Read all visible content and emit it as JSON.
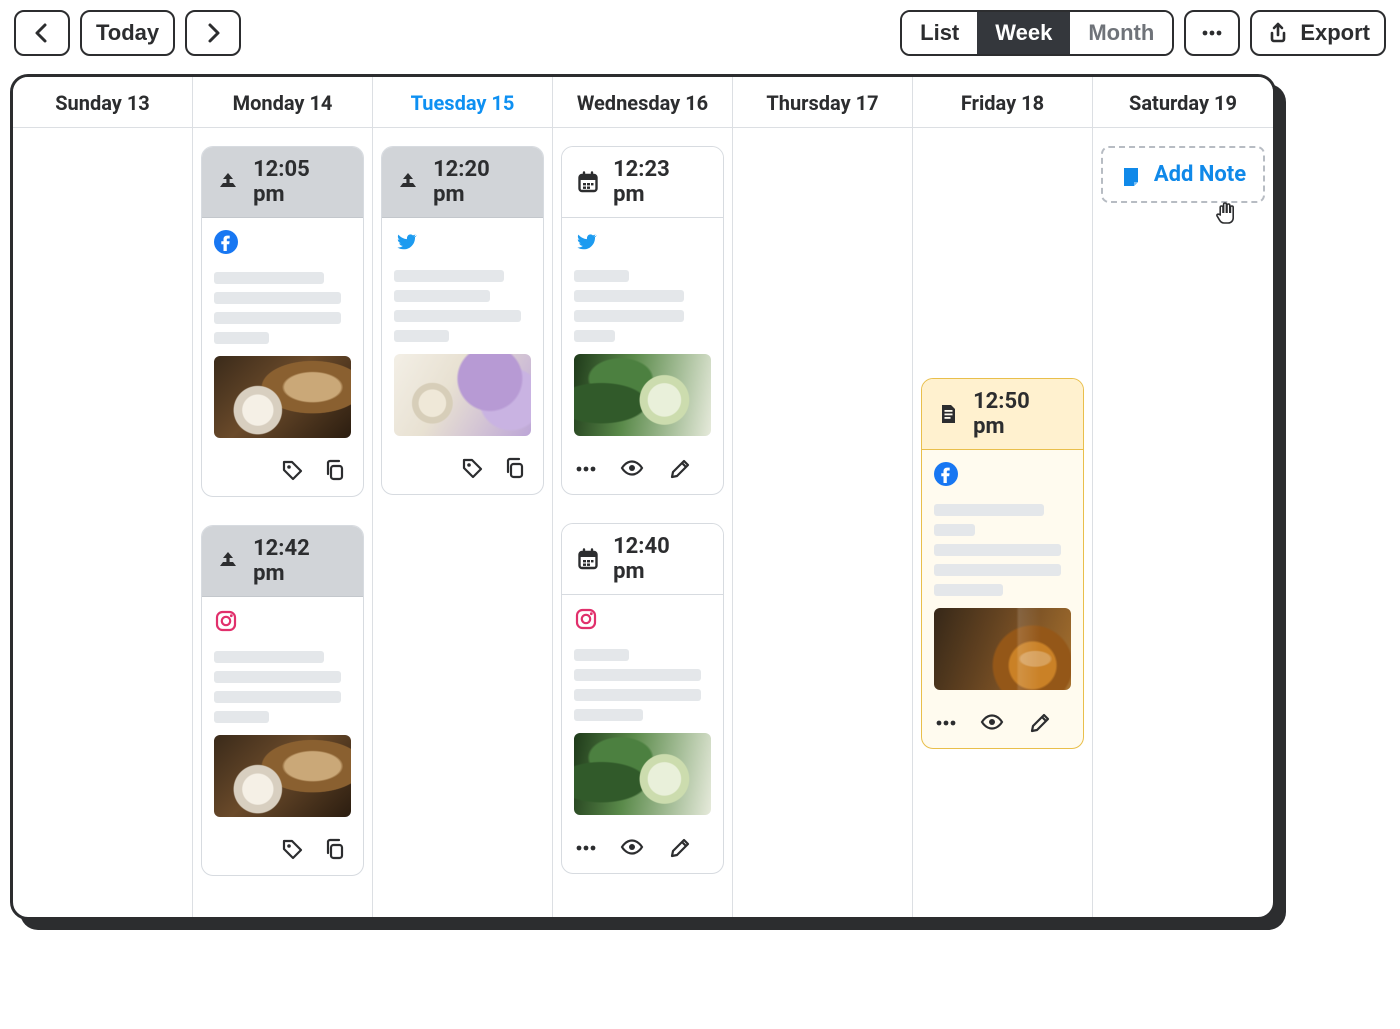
{
  "toolbar": {
    "today_label": "Today",
    "view": {
      "list": "List",
      "week": "Week",
      "month": "Month",
      "active": "Week"
    },
    "export_label": "Export"
  },
  "week": {
    "today_index": 2,
    "days": [
      {
        "label": "Sunday 13"
      },
      {
        "label": "Monday 14"
      },
      {
        "label": "Tuesday 15"
      },
      {
        "label": "Wednesday 16"
      },
      {
        "label": "Thursday 17"
      },
      {
        "label": "Friday 18"
      },
      {
        "label": "Saturday 19"
      }
    ]
  },
  "cards": {
    "mon1": {
      "time": "12:05 pm",
      "status_icon": "upload",
      "network": "facebook",
      "thumb": "coffee",
      "actions": [
        "tag",
        "copy"
      ]
    },
    "mon2": {
      "time": "12:42 pm",
      "status_icon": "upload",
      "network": "instagram",
      "thumb": "coffee",
      "actions": [
        "tag",
        "copy"
      ]
    },
    "tue1": {
      "time": "12:20 pm",
      "status_icon": "upload",
      "network": "twitter",
      "thumb": "lilac",
      "actions": [
        "tag",
        "copy"
      ]
    },
    "wed1": {
      "time": "12:23 pm",
      "status_icon": "calendar",
      "network": "twitter",
      "thumb": "matcha",
      "actions": [
        "more",
        "eye",
        "edit"
      ]
    },
    "wed2": {
      "time": "12:40 pm",
      "status_icon": "calendar",
      "network": "instagram",
      "thumb": "matcha",
      "actions": [
        "more",
        "eye",
        "edit"
      ]
    },
    "fri1": {
      "time": "12:50 pm",
      "status_icon": "note",
      "network": "facebook",
      "thumb": "whiskey",
      "actions": [
        "more",
        "eye",
        "edit"
      ],
      "variant": "note"
    }
  },
  "add_note": {
    "label": "Add Note"
  },
  "colors": {
    "accent_blue": "#0e90f2",
    "twitter": "#1d9bf0",
    "facebook": "#1877f2",
    "instagram": "#e1306c",
    "note_border": "#e9bf4b"
  }
}
